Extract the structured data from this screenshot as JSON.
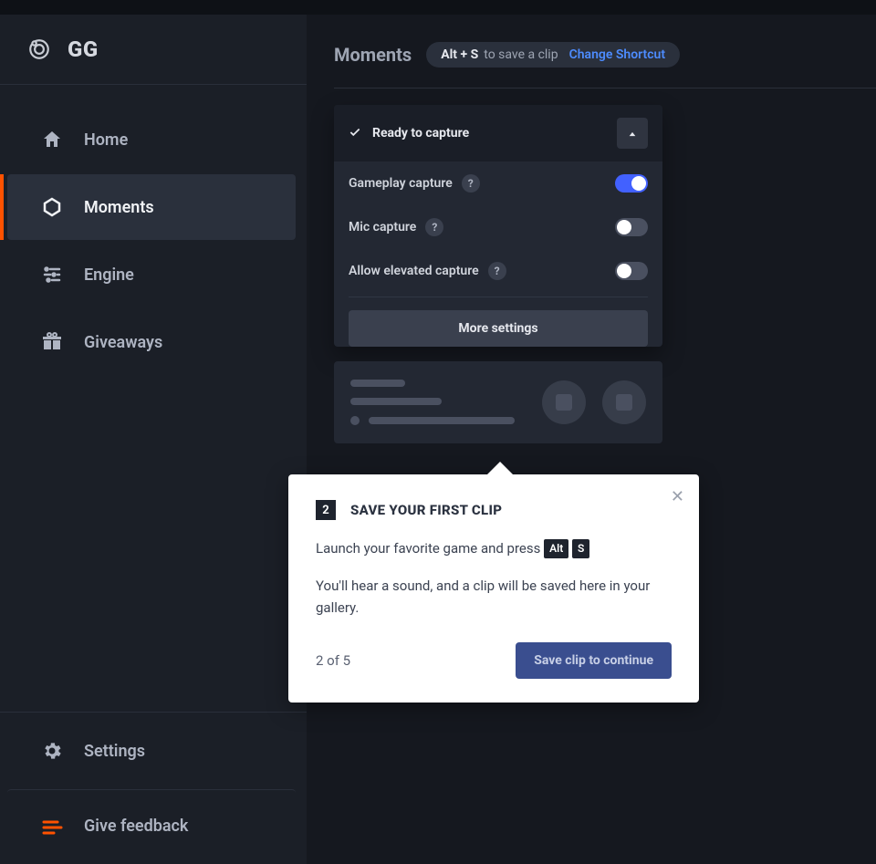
{
  "brand": {
    "name": "GG"
  },
  "nav": {
    "items": [
      {
        "label": "Home"
      },
      {
        "label": "Moments"
      },
      {
        "label": "Engine"
      },
      {
        "label": "Giveaways"
      }
    ],
    "footer": [
      {
        "label": "Settings"
      },
      {
        "label": "Give feedback"
      }
    ]
  },
  "header": {
    "title": "Moments",
    "shortcut_label": "Alt + S",
    "shortcut_desc": "to save a clip",
    "change_link": "Change Shortcut"
  },
  "panel": {
    "status": "Ready to capture",
    "rows": [
      {
        "label": "Gameplay capture",
        "on": true
      },
      {
        "label": "Mic capture",
        "on": false
      },
      {
        "label": "Allow elevated capture",
        "on": false
      }
    ],
    "more": "More settings"
  },
  "popover": {
    "step": "2",
    "title": "SAVE YOUR FIRST CLIP",
    "body1_pre": "Launch your favorite game and press ",
    "key1": "Alt",
    "key2": "S",
    "body2": "You'll hear a sound, and a clip will be saved here in your gallery.",
    "step_of": "2 of 5",
    "continue": "Save clip to continue"
  }
}
